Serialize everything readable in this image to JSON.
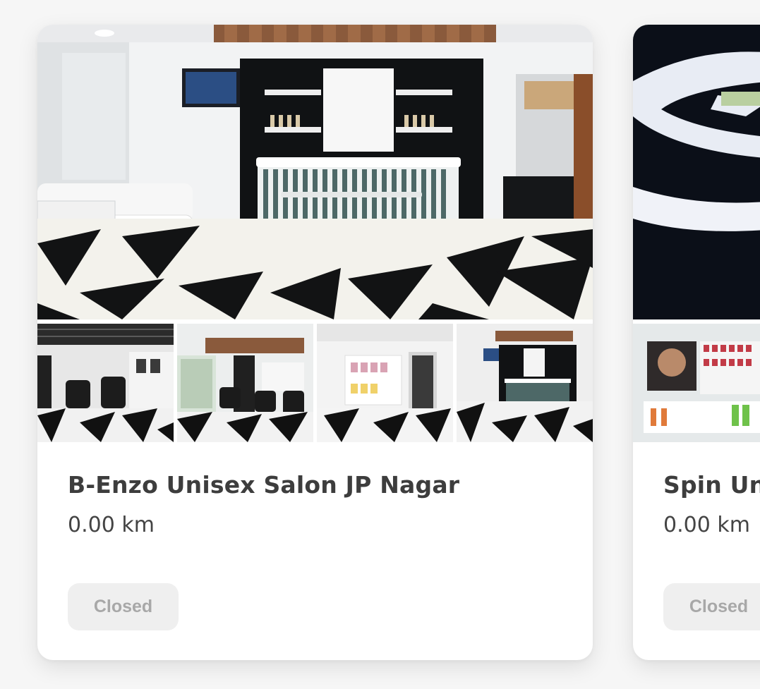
{
  "salons": [
    {
      "name": "B-Enzo Unisex Salon JP Nagar",
      "distance": "0.00 km",
      "status": "Closed"
    },
    {
      "name": "Spin Un",
      "distance": "0.00 km",
      "status": "Closed"
    }
  ],
  "colors": {
    "page_bg": "#f6f6f6",
    "card_bg": "#ffffff",
    "title_text": "#3d3d3d",
    "status_bg": "#efefef",
    "status_text": "#a8a8a8"
  },
  "images": {
    "card_1_hero": "salon-reception-photo",
    "card_1_thumbs": [
      "salon-chairs-photo",
      "salon-mirrors-photo",
      "salon-products-photo",
      "salon-reception-thumb-photo"
    ],
    "card_2_hero": "salon-logo-sign-photo",
    "card_2_thumbs": [
      "salon-product-wall-photo"
    ]
  }
}
